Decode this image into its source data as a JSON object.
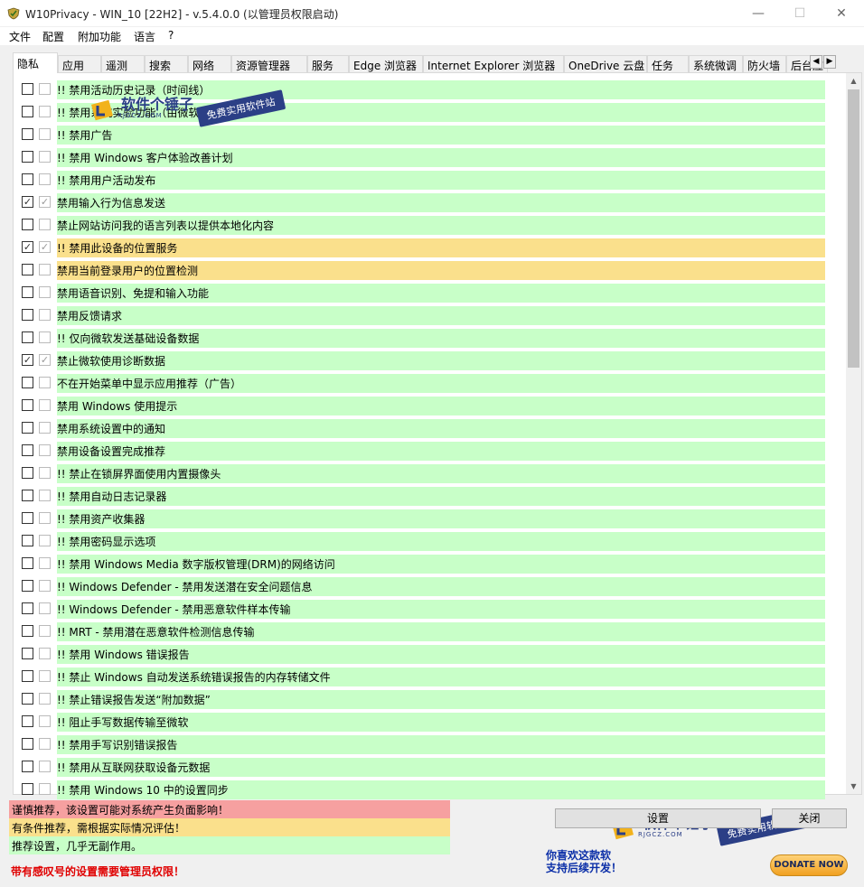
{
  "window": {
    "title": "W10Privacy - WIN_10 [22H2]  - v.5.4.0.0 (以管理员权限启动)",
    "min": "—",
    "max": "☐",
    "close": "✕"
  },
  "menu": [
    "文件",
    "配置",
    "附加功能",
    "语言",
    "?"
  ],
  "tabs": [
    "隐私",
    "应用",
    "遥测",
    "搜索",
    "网络",
    "资源管理器",
    "服务",
    "Edge 浏览器",
    "Internet Explorer 浏览器",
    "OneDrive 云盘",
    "任务",
    "系统微调",
    "防火墙",
    "后台应"
  ],
  "active_tab": "隐私",
  "colors": {
    "green": "#c8ffc8",
    "yellow": "#fae08c",
    "red": "#f6a0a0"
  },
  "rows": [
    {
      "label": "!! 禁用活动历史记录（时间线）",
      "c1": false,
      "c2": false,
      "color": "green"
    },
    {
      "label": "!! 禁用系统实验功能（由微软",
      "c1": false,
      "c2": false,
      "color": "green"
    },
    {
      "label": "!! 禁用广告",
      "c1": false,
      "c2": false,
      "color": "green"
    },
    {
      "label": "!! 禁用 Windows 客户体验改善计划",
      "c1": false,
      "c2": false,
      "color": "green"
    },
    {
      "label": "!! 禁用用户活动发布",
      "c1": false,
      "c2": false,
      "color": "green"
    },
    {
      "label": "禁用输入行为信息发送",
      "c1": true,
      "c2": true,
      "color": "green"
    },
    {
      "label": "禁止网站访问我的语言列表以提供本地化内容",
      "c1": false,
      "c2": false,
      "color": "green"
    },
    {
      "label": "!! 禁用此设备的位置服务",
      "c1": true,
      "c2": true,
      "color": "yellow"
    },
    {
      "label": "禁用当前登录用户的位置检测",
      "c1": false,
      "c2": false,
      "color": "yellow"
    },
    {
      "label": "禁用语音识别、免提和输入功能",
      "c1": false,
      "c2": false,
      "color": "green"
    },
    {
      "label": "禁用反馈请求",
      "c1": false,
      "c2": false,
      "color": "green"
    },
    {
      "label": "!! 仅向微软发送基础设备数据",
      "c1": false,
      "c2": false,
      "color": "green"
    },
    {
      "label": "禁止微软使用诊断数据",
      "c1": true,
      "c2": true,
      "color": "green"
    },
    {
      "label": "不在开始菜单中显示应用推荐（广告）",
      "c1": false,
      "c2": false,
      "color": "green"
    },
    {
      "label": "禁用 Windows 使用提示",
      "c1": false,
      "c2": false,
      "color": "green"
    },
    {
      "label": "禁用系统设置中的通知",
      "c1": false,
      "c2": false,
      "color": "green"
    },
    {
      "label": "禁用设备设置完成推荐",
      "c1": false,
      "c2": false,
      "color": "green"
    },
    {
      "label": "!! 禁止在锁屏界面使用内置摄像头",
      "c1": false,
      "c2": false,
      "color": "green"
    },
    {
      "label": "!! 禁用自动日志记录器",
      "c1": false,
      "c2": false,
      "color": "green"
    },
    {
      "label": "!! 禁用资产收集器",
      "c1": false,
      "c2": false,
      "color": "green"
    },
    {
      "label": "!! 禁用密码显示选项",
      "c1": false,
      "c2": false,
      "color": "green"
    },
    {
      "label": "!! 禁用 Windows Media 数字版权管理(DRM)的网络访问",
      "c1": false,
      "c2": false,
      "color": "green"
    },
    {
      "label": "!! Windows Defender - 禁用发送潜在安全问题信息",
      "c1": false,
      "c2": false,
      "color": "green"
    },
    {
      "label": "!! Windows Defender - 禁用恶意软件样本传输",
      "c1": false,
      "c2": false,
      "color": "green"
    },
    {
      "label": "!! MRT - 禁用潜在恶意软件检测信息传输",
      "c1": false,
      "c2": false,
      "color": "green"
    },
    {
      "label": "!! 禁用 Windows 错误报告",
      "c1": false,
      "c2": false,
      "color": "green"
    },
    {
      "label": "!! 禁止 Windows 自动发送系统错误报告的内存转储文件",
      "c1": false,
      "c2": false,
      "color": "green"
    },
    {
      "label": "!! 禁止错误报告发送“附加数据”",
      "c1": false,
      "c2": false,
      "color": "green"
    },
    {
      "label": "!! 阻止手写数据传输至微软",
      "c1": false,
      "c2": false,
      "color": "green"
    },
    {
      "label": "!! 禁用手写识别错误报告",
      "c1": false,
      "c2": false,
      "color": "green"
    },
    {
      "label": "!! 禁用从互联网获取设备元数据",
      "c1": false,
      "c2": false,
      "color": "green"
    },
    {
      "label": "!! 禁用 Windows 10 中的设置同步",
      "c1": false,
      "c2": false,
      "color": "green"
    }
  ],
  "legend": {
    "red": "谨慎推荐，该设置可能对系统产生负面影响！",
    "yellow": "有条件推荐，需根据实际情况评估！",
    "green": "推荐设置，几乎无副作用。"
  },
  "admin_note": "带有感叹号的设置需要管理员权限！",
  "buttons": {
    "apply": "设置",
    "close": "关闭"
  },
  "donate": {
    "line1": "你喜欢这款软",
    "line2": "支持后续开发！",
    "button": "DONATE NOW"
  },
  "watermark": {
    "name": "软件个锤子",
    "site": "RJGCZ.COM",
    "tagline": "免费实用软件站"
  },
  "scroll": {
    "up": "▲",
    "down": "▼",
    "left": "◀",
    "right": "▶"
  }
}
